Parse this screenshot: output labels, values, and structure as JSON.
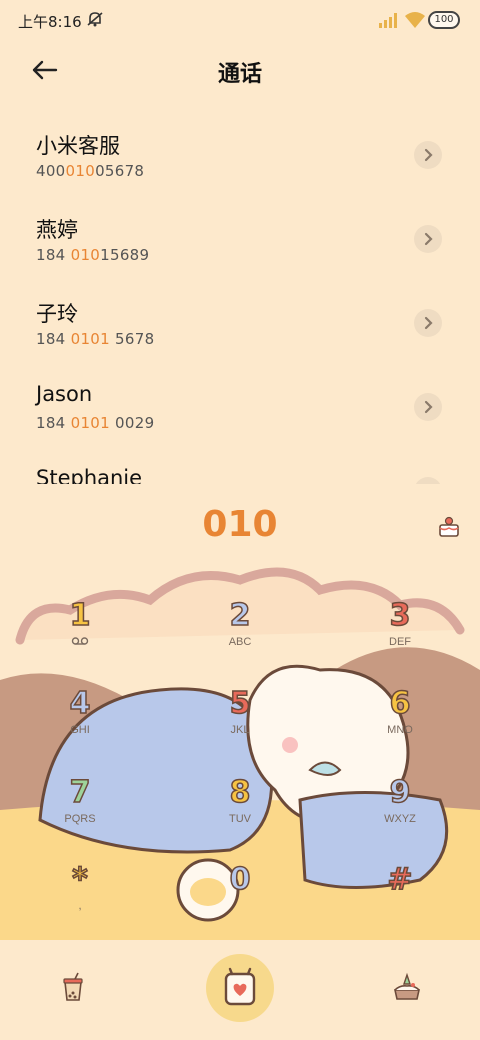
{
  "status": {
    "time": "上午8:16",
    "battery": "100"
  },
  "header": {
    "title": "通话"
  },
  "contacts": [
    {
      "name": "小米客服",
      "num_pre": "400",
      "num_hl": "010",
      "num_post": "05678"
    },
    {
      "name": "燕婷",
      "num_pre": "184 ",
      "num_hl": "010",
      "num_post": "15689"
    },
    {
      "name": "子玲",
      "num_pre": "184 ",
      "num_hl": "0101",
      "num_post": " 5678"
    },
    {
      "name": "Jason",
      "num_pre": "184 ",
      "num_hl": "0101",
      "num_post": " 0029"
    },
    {
      "name": "Stephanie",
      "num_pre": "",
      "num_hl": "",
      "num_post": ""
    }
  ],
  "dialer": {
    "input": "010"
  },
  "keypad": [
    {
      "digit": "1",
      "letters": "",
      "color": "#f6c343"
    },
    {
      "digit": "2",
      "letters": "ABC",
      "color": "#b8c8ea"
    },
    {
      "digit": "3",
      "letters": "DEF",
      "color": "#e86a5a"
    },
    {
      "digit": "4",
      "letters": "GHI",
      "color": "#b8c8ea"
    },
    {
      "digit": "5",
      "letters": "JKL",
      "color": "#e86a5a"
    },
    {
      "digit": "6",
      "letters": "MNO",
      "color": "#f6c343"
    },
    {
      "digit": "7",
      "letters": "PQRS",
      "color": "#9ed39a"
    },
    {
      "digit": "8",
      "letters": "TUV",
      "color": "#f6c343"
    },
    {
      "digit": "9",
      "letters": "WXYZ",
      "color": "#b8c8ea"
    },
    {
      "digit": "*",
      "letters": ",",
      "color": "#f6c343"
    },
    {
      "digit": "0",
      "letters": "",
      "color": "#b8c8ea"
    },
    {
      "digit": "#",
      "letters": "",
      "color": "#e86a5a"
    }
  ],
  "icons": {
    "back": "arrow-left-icon",
    "mute": "bell-off-icon",
    "voicemail": "voicemail-icon",
    "call": "call-icon",
    "tea": "bubble-tea-icon",
    "cake": "cake-icon"
  }
}
